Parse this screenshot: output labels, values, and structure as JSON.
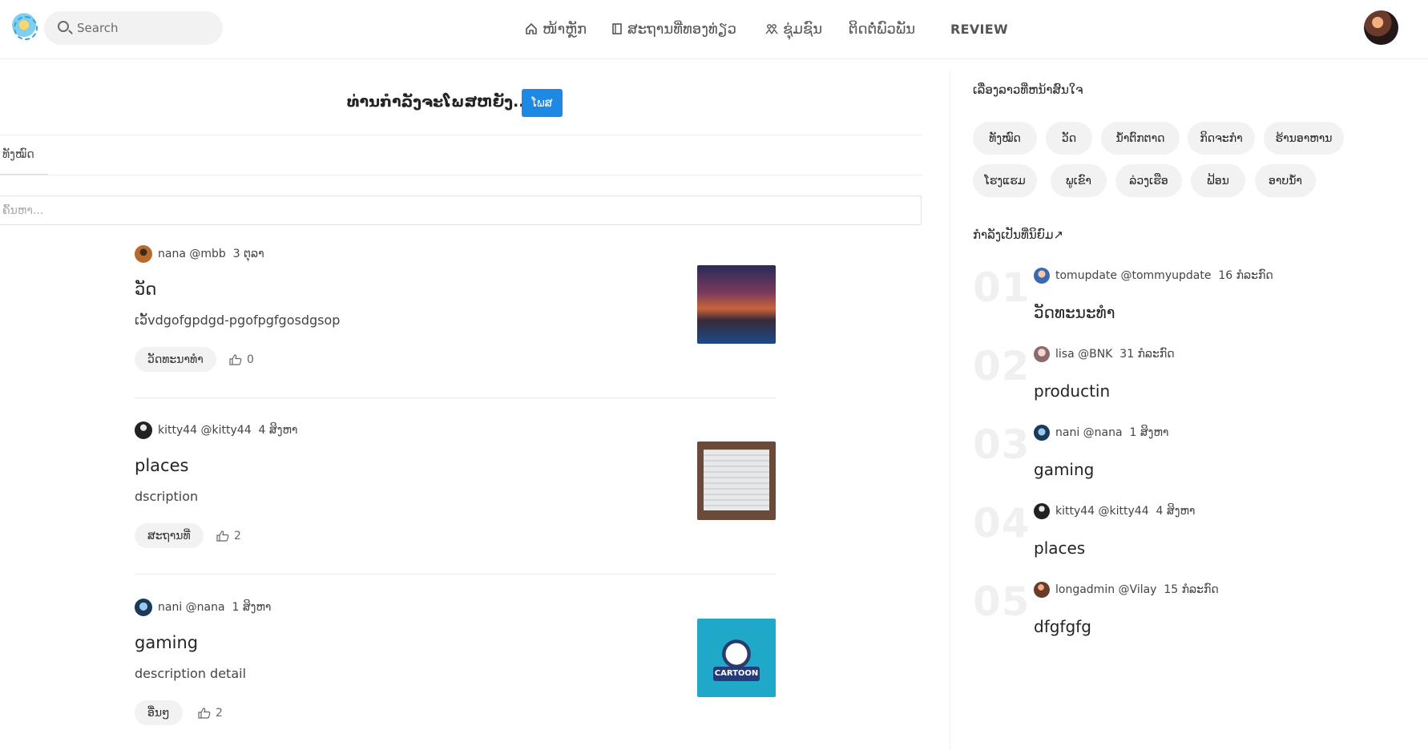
{
  "header": {
    "search_placeholder": "Search",
    "nav": [
      {
        "label": "ໜ້າຫຼັກ",
        "icon": "home-icon"
      },
      {
        "label": "ສະຖານທີ່ທອງທ່ຽວ",
        "icon": "book-icon"
      },
      {
        "label": "ຊຸ່ມຊົນ",
        "icon": "people-icon"
      },
      {
        "label": "ຕິດຕໍ່ພົວພັນ",
        "icon": ""
      },
      {
        "label": "REVIEW",
        "icon": ""
      }
    ]
  },
  "composer": {
    "prompt": "ທ່ານກຳລັງຈະໂພສຫຍັງ....",
    "post_label": "ໂພສ"
  },
  "tabs": {
    "all": "ທັງໝົດ"
  },
  "filter": {
    "placeholder": "ຄົ້ນຫາ..."
  },
  "posts": [
    {
      "author": "nana",
      "handle": "@mbb",
      "date": "3 ຕຸລາ",
      "title": "ວັດ",
      "description": "ເວັ້vdgofgpdgd-pgofpgfgosdgsop",
      "tag": "ວັດທະນາທຳ",
      "likes": "0"
    },
    {
      "author": "kitty44",
      "handle": "@kitty44",
      "date": "4 ສິງຫາ",
      "title": "places",
      "description": "dscription",
      "tag": "ສະຖານທີ່",
      "likes": "2"
    },
    {
      "author": "nani",
      "handle": "@nana",
      "date": "1 ສິງຫາ",
      "title": "gaming",
      "description": "description detail",
      "tag": "ອື່ນໆ",
      "likes": "2"
    }
  ],
  "post_images": {
    "third_badge": "CARTOON"
  },
  "sidebar": {
    "topics_title": "ເລື່ອງລາວທີ່ຫນ້າສົນໃຈ",
    "topics": [
      "ທັງໝົດ",
      "ວັດ",
      "ນ້ຳຕົກຕາດ",
      "ກິດຈະກຳ",
      "ຮ້ານອາຫານ",
      "ໂຮງແຮມ",
      "ພູເຂົາ",
      "ລ່ວງເຮືອ",
      "ຟ້ອນ",
      "ອາບນ້ຳ"
    ],
    "trending_title": "ກຳລັງເປັນທີ່ນິຍົມ↗",
    "trending": [
      {
        "num": "01",
        "author": "tomupdate",
        "handle": "@tommyupdate",
        "date": "16 ກໍລະກົດ",
        "title": "ວັດທະນະທຳ"
      },
      {
        "num": "02",
        "author": "lisa",
        "handle": "@BNK",
        "date": "31 ກໍລະກົດ",
        "title": "productin"
      },
      {
        "num": "03",
        "author": "nani",
        "handle": "@nana",
        "date": "1 ສິງຫາ",
        "title": "gaming"
      },
      {
        "num": "04",
        "author": "kitty44",
        "handle": "@kitty44",
        "date": "4 ສິງຫາ",
        "title": "places"
      },
      {
        "num": "05",
        "author": "longadmin",
        "handle": "@Vilay",
        "date": "15 ກໍລະກົດ",
        "title": "dfgfgfg"
      }
    ]
  },
  "colors": {
    "accent": "#1e88e5",
    "chip_bg": "#f2f2f2",
    "trend_number": "#f0f0f0"
  }
}
